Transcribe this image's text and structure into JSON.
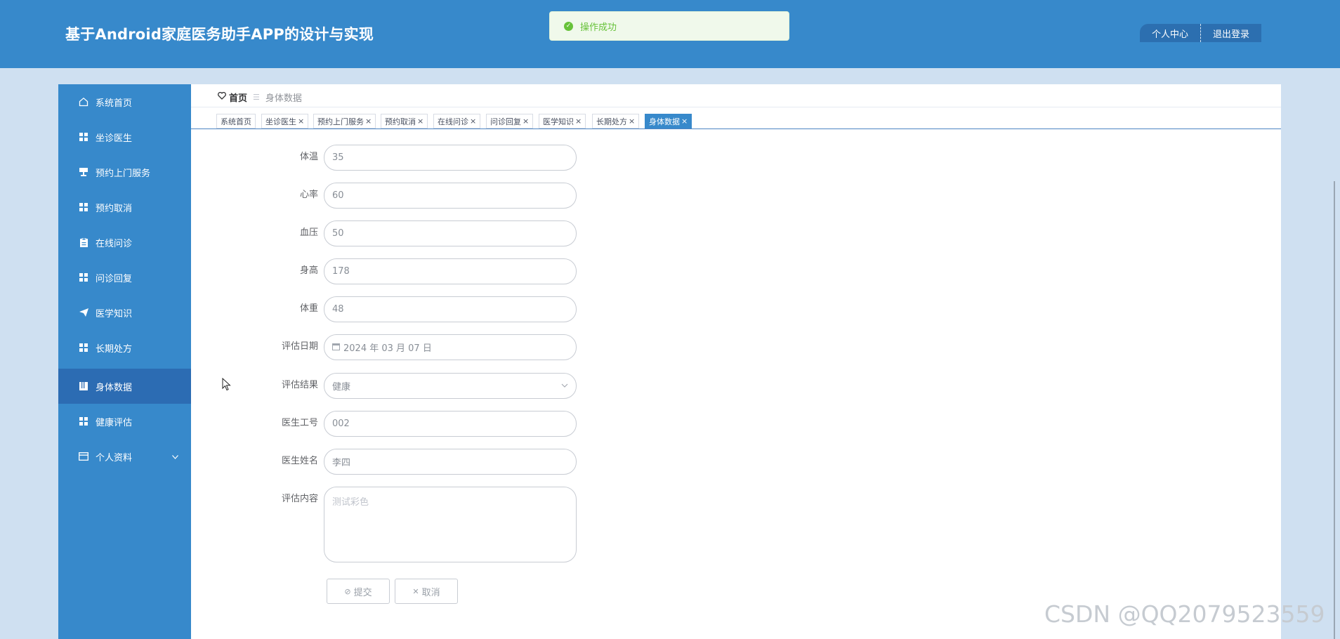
{
  "header": {
    "title": "基于Android家庭医务助手APP的设计与实现",
    "profile_label": "个人中心",
    "logout_label": "退出登录"
  },
  "toast": {
    "message": "操作成功"
  },
  "sidebar": {
    "items": [
      {
        "label": "系统首页",
        "icon": "home-icon"
      },
      {
        "label": "坐诊医生",
        "icon": "grid-icon"
      },
      {
        "label": "预约上门服务",
        "icon": "stamp-icon"
      },
      {
        "label": "预约取消",
        "icon": "grid-icon"
      },
      {
        "label": "在线问诊",
        "icon": "clipboard-icon"
      },
      {
        "label": "问诊回复",
        "icon": "grid-icon"
      },
      {
        "label": "医学知识",
        "icon": "send-icon"
      },
      {
        "label": "长期处方",
        "icon": "grid-icon"
      },
      {
        "label": "身体数据",
        "icon": "book-icon",
        "active": true
      },
      {
        "label": "健康评估",
        "icon": "grid-icon"
      },
      {
        "label": "个人资料",
        "icon": "card-icon",
        "expandable": true
      }
    ]
  },
  "breadcrumb": {
    "home": "首页",
    "current": "身体数据"
  },
  "tabs": [
    {
      "label": "系统首页",
      "closable": false
    },
    {
      "label": "坐诊医生",
      "closable": true
    },
    {
      "label": "预约上门服务",
      "closable": true
    },
    {
      "label": "预约取消",
      "closable": true
    },
    {
      "label": "在线问诊",
      "closable": true
    },
    {
      "label": "问诊回复",
      "closable": true
    },
    {
      "label": "医学知识",
      "closable": true
    },
    {
      "label": "长期处方",
      "closable": true
    },
    {
      "label": "身体数据",
      "closable": true,
      "active": true
    }
  ],
  "form": {
    "body_temp": {
      "label": "体温",
      "value": "35"
    },
    "heart_rate": {
      "label": "心率",
      "value": "60"
    },
    "blood_pressure": {
      "label": "血压",
      "value": "50"
    },
    "height": {
      "label": "身高",
      "value": "178"
    },
    "weight": {
      "label": "体重",
      "value": "48"
    },
    "eval_date": {
      "label": "评估日期",
      "value": "2024 年 03 月 07 日"
    },
    "eval_result": {
      "label": "评估结果",
      "value": "健康"
    },
    "doctor_id": {
      "label": "医生工号",
      "value": "002"
    },
    "doctor_name": {
      "label": "医生姓名",
      "value": "李四"
    },
    "eval_content": {
      "label": "评估内容",
      "value": "测试彩色"
    },
    "submit_label": "提交",
    "cancel_label": "取消"
  },
  "watermark": "CSDN @QQ2079523559",
  "colors": {
    "header_bg": "#3789cb",
    "sidebar_active": "#2c6cb3",
    "success_green": "#67c23a",
    "page_bg": "#cfe0f1"
  }
}
